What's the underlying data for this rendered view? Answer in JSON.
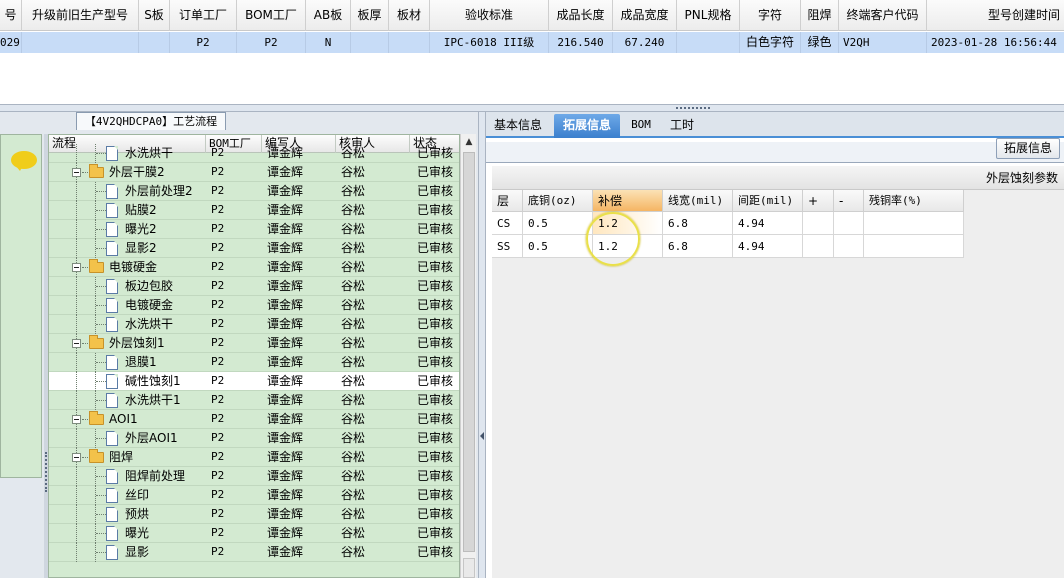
{
  "top_grid": {
    "columns": [
      "号",
      "升级前旧生产型号",
      "S板",
      "订单工厂",
      "BOM工厂",
      "AB板",
      "板厚",
      "板材",
      "验收标准",
      "成品长度",
      "成品宽度",
      "PNL规格",
      "字符",
      "阻焊",
      "终端客户代码",
      "型号创建时间"
    ],
    "row": {
      "id": "029",
      "old_model": "",
      "s_board": "",
      "order_factory": "P2",
      "bom_factory": "P2",
      "ab_board": "N",
      "thickness": "",
      "material": "",
      "standard": "IPC-6018 III级",
      "length": "216.540",
      "width": "67.240",
      "pnl": "",
      "char": "白色字符",
      "mask": "绿色",
      "customer_code": "V2QH",
      "created": "2023-01-28 16:56:44"
    }
  },
  "process_panel": {
    "tab_label": "【4V2QHDCPA0】工艺流程",
    "columns": {
      "flow": "流程",
      "bom": "BOM工厂",
      "writer": "编写人",
      "reviewer": "核审人",
      "status": "状态"
    },
    "rows": [
      {
        "name": "水洗烘干",
        "bom": "P2",
        "writer": "谭金辉",
        "reviewer": "谷松",
        "status": "已审核",
        "level": 2,
        "type": "doc"
      },
      {
        "name": "外层干膜2",
        "bom": "P2",
        "writer": "谭金辉",
        "reviewer": "谷松",
        "status": "已审核",
        "level": 1,
        "type": "folder"
      },
      {
        "name": "外层前处理2",
        "bom": "P2",
        "writer": "谭金辉",
        "reviewer": "谷松",
        "status": "已审核",
        "level": 2,
        "type": "doc"
      },
      {
        "name": "贴膜2",
        "bom": "P2",
        "writer": "谭金辉",
        "reviewer": "谷松",
        "status": "已审核",
        "level": 2,
        "type": "doc"
      },
      {
        "name": "曝光2",
        "bom": "P2",
        "writer": "谭金辉",
        "reviewer": "谷松",
        "status": "已审核",
        "level": 2,
        "type": "doc"
      },
      {
        "name": "显影2",
        "bom": "P2",
        "writer": "谭金辉",
        "reviewer": "谷松",
        "status": "已审核",
        "level": 2,
        "type": "doc"
      },
      {
        "name": "电镀硬金",
        "bom": "P2",
        "writer": "谭金辉",
        "reviewer": "谷松",
        "status": "已审核",
        "level": 1,
        "type": "folder"
      },
      {
        "name": "板边包胶",
        "bom": "P2",
        "writer": "谭金辉",
        "reviewer": "谷松",
        "status": "已审核",
        "level": 2,
        "type": "doc"
      },
      {
        "name": "电镀硬金",
        "bom": "P2",
        "writer": "谭金辉",
        "reviewer": "谷松",
        "status": "已审核",
        "level": 2,
        "type": "doc"
      },
      {
        "name": "水洗烘干",
        "bom": "P2",
        "writer": "谭金辉",
        "reviewer": "谷松",
        "status": "已审核",
        "level": 2,
        "type": "doc"
      },
      {
        "name": "外层蚀刻1",
        "bom": "P2",
        "writer": "谭金辉",
        "reviewer": "谷松",
        "status": "已审核",
        "level": 1,
        "type": "folder"
      },
      {
        "name": "退膜1",
        "bom": "P2",
        "writer": "谭金辉",
        "reviewer": "谷松",
        "status": "已审核",
        "level": 2,
        "type": "doc"
      },
      {
        "name": "碱性蚀刻1",
        "bom": "P2",
        "writer": "谭金辉",
        "reviewer": "谷松",
        "status": "已审核",
        "level": 2,
        "type": "doc",
        "selected": true
      },
      {
        "name": "水洗烘干1",
        "bom": "P2",
        "writer": "谭金辉",
        "reviewer": "谷松",
        "status": "已审核",
        "level": 2,
        "type": "doc"
      },
      {
        "name": "AOI1",
        "bom": "P2",
        "writer": "谭金辉",
        "reviewer": "谷松",
        "status": "已审核",
        "level": 1,
        "type": "folder"
      },
      {
        "name": "外层AOI1",
        "bom": "P2",
        "writer": "谭金辉",
        "reviewer": "谷松",
        "status": "已审核",
        "level": 2,
        "type": "doc"
      },
      {
        "name": "阻焊",
        "bom": "P2",
        "writer": "谭金辉",
        "reviewer": "谷松",
        "status": "已审核",
        "level": 1,
        "type": "folder"
      },
      {
        "name": "阻焊前处理",
        "bom": "P2",
        "writer": "谭金辉",
        "reviewer": "谷松",
        "status": "已审核",
        "level": 2,
        "type": "doc"
      },
      {
        "name": "丝印",
        "bom": "P2",
        "writer": "谭金辉",
        "reviewer": "谷松",
        "status": "已审核",
        "level": 2,
        "type": "doc"
      },
      {
        "name": "预烘",
        "bom": "P2",
        "writer": "谭金辉",
        "reviewer": "谷松",
        "status": "已审核",
        "level": 2,
        "type": "doc"
      },
      {
        "name": "曝光",
        "bom": "P2",
        "writer": "谭金辉",
        "reviewer": "谷松",
        "status": "已审核",
        "level": 2,
        "type": "doc"
      },
      {
        "name": "显影",
        "bom": "P2",
        "writer": "谭金辉",
        "reviewer": "谷松",
        "status": "已审核",
        "level": 2,
        "type": "doc"
      }
    ]
  },
  "right_panel": {
    "tabs": [
      "基本信息",
      "拓展信息",
      "BOM",
      "工时"
    ],
    "active_tab": "拓展信息",
    "ext_button": "拓展信息",
    "params_title": "外层蚀刻参数",
    "params_columns": [
      "层",
      "底铜(oz)",
      "补偿",
      "线宽(mil)",
      "间距(mil)",
      "+",
      "-",
      "残铜率(%)"
    ],
    "params_rows": [
      [
        "CS",
        "0.5",
        "1.2",
        "6.8",
        "4.94",
        "",
        "",
        ""
      ],
      [
        "SS",
        "0.5",
        "1.2",
        "6.8",
        "4.94",
        "",
        "",
        ""
      ]
    ]
  },
  "colors": {
    "tree_bg": "#d3ead1",
    "selected_row": "#c7dcf7",
    "active_tab": "#3b7fcd",
    "highlight_header": "#f5b563",
    "annotation_ring": "#e9e04a"
  }
}
